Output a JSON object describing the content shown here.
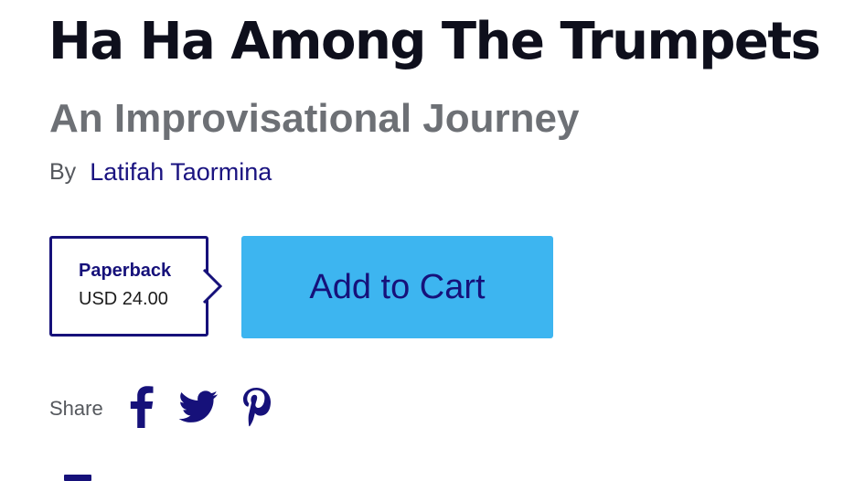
{
  "book": {
    "title": "Ha Ha Among The Trumpets",
    "subtitle": "An Improvisational Journey",
    "by_label": "By",
    "author": "Latifah Taormina"
  },
  "format": {
    "name": "Paperback",
    "price": "USD 24.00"
  },
  "actions": {
    "add_to_cart_label": "Add to Cart"
  },
  "share": {
    "label": "Share",
    "networks": [
      "facebook-icon",
      "twitter-icon",
      "pinterest-icon"
    ]
  },
  "colors": {
    "brand_navy": "#16117a",
    "cart_button": "#3db5f0",
    "title_text": "#0e0f1c",
    "subtitle_text": "#6d7075"
  }
}
